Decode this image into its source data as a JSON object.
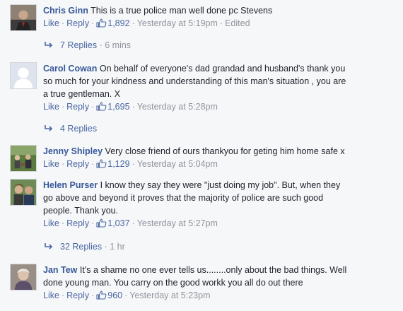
{
  "comments": [
    {
      "author": "Chris Ginn",
      "text": "This is a true police man well done pc Stevens",
      "like": "Like",
      "reply": "Reply",
      "likes": "1,892",
      "time": "Yesterday at 5:19pm",
      "edited": "Edited",
      "replies": "7 Replies",
      "replies_ago": "6 mins"
    },
    {
      "author": "Carol Cowan",
      "text_lines": [
        "On behalf of everyone's dad grandad and husband's thank you",
        "so much for your kindness and understanding of this man's situation , you are",
        "a true gentleman. X"
      ],
      "like": "Like",
      "reply": "Reply",
      "likes": "1,695",
      "time": "Yesterday at 5:28pm",
      "replies": "4 Replies"
    },
    {
      "author": "Jenny Shipley",
      "text": "Very close friend of ours thankyou for geting him home safe x",
      "like": "Like",
      "reply": "Reply",
      "likes": "1,129",
      "time": "Yesterday at 5:04pm"
    },
    {
      "author": "Helen Purser",
      "text_lines": [
        "I know they say they were \"just doing my job\". But, when they",
        "go above and beyond it proves that the majority of police are such good",
        "people. Thank you."
      ],
      "like": "Like",
      "reply": "Reply",
      "likes": "1,037",
      "time": "Yesterday at 5:27pm",
      "replies": "32 Replies",
      "replies_ago": "1 hr"
    },
    {
      "author": "Jan Tew",
      "text_lines": [
        "It's a shame no one ever tells us........only about the bad things. Well",
        "done young man. You carry on the good workk you all do out there"
      ],
      "like": "Like",
      "reply": "Reply",
      "likes": "960",
      "time": "Yesterday at 5:23pm"
    }
  ],
  "colors": {
    "name": "#365899",
    "link": "#4b67a1",
    "meta": "#90949c",
    "text": "#1d2129",
    "background": "#f6f7f9"
  },
  "icons": {
    "like": "thumbs-up-icon",
    "reply": "reply-arrow-icon",
    "default_avatar": "default-avatar-icon"
  }
}
